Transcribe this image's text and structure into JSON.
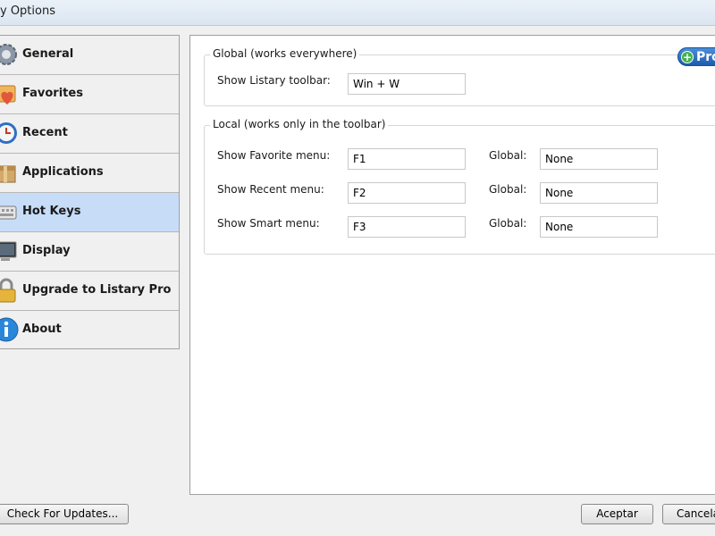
{
  "window": {
    "title": "y Options"
  },
  "sidebar": {
    "items": [
      {
        "label": "General",
        "icon": "gear-icon"
      },
      {
        "label": "Favorites",
        "icon": "heart-box-icon"
      },
      {
        "label": "Recent",
        "icon": "clock-icon"
      },
      {
        "label": "Applications",
        "icon": "box-icon"
      },
      {
        "label": "Hot Keys",
        "icon": "keyboard-icon"
      },
      {
        "label": "Display",
        "icon": "monitor-icon"
      },
      {
        "label": "Upgrade to Listary Pro",
        "icon": "lock-icon"
      },
      {
        "label": "About",
        "icon": "info-icon"
      }
    ],
    "selected": "Hot Keys"
  },
  "global_group": {
    "title": "Global  (works everywhere)",
    "toolbar_label": "Show Listary toolbar:",
    "toolbar_value": "Win + W"
  },
  "pro_badge": {
    "label": "Pro"
  },
  "local_group": {
    "title": "Local  (works only in the toolbar)",
    "global_label": "Global:",
    "rows": [
      {
        "label": "Show Favorite menu:",
        "key": "F1",
        "global": "None"
      },
      {
        "label": "Show Recent menu:",
        "key": "F2",
        "global": "None"
      },
      {
        "label": "Show Smart menu:",
        "key": "F3",
        "global": "None"
      }
    ]
  },
  "footer": {
    "check_updates": "Check For Updates...",
    "ok": "Aceptar",
    "cancel": "Cancelar"
  },
  "colors": {
    "selected_bg": "#c7dcf7",
    "pro_blue": "#2b6fc0",
    "pro_green": "#3fb34f"
  }
}
